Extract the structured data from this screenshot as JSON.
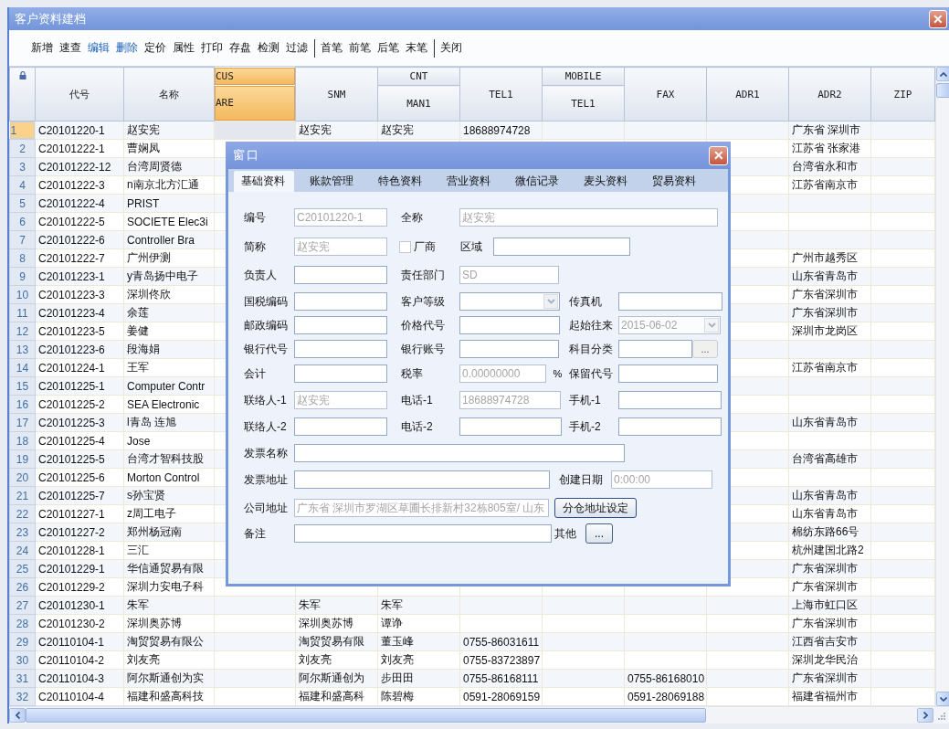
{
  "window": {
    "title": "客户资料建档",
    "close": "✕"
  },
  "toolbar": [
    [
      {
        "label": "新增",
        "highlighted": false
      },
      {
        "label": "速查",
        "highlighted": false
      },
      {
        "label": "编辑",
        "highlighted": true
      },
      {
        "label": "删除",
        "highlighted": true
      },
      {
        "label": "定价",
        "highlighted": false
      },
      {
        "label": "属性",
        "highlighted": false
      },
      {
        "label": "打印",
        "highlighted": false
      },
      {
        "label": "存盘",
        "highlighted": false
      },
      {
        "label": "检测",
        "highlighted": false
      },
      {
        "label": "过滤",
        "highlighted": false
      }
    ],
    [
      {
        "label": "首笔",
        "highlighted": false
      },
      {
        "label": "前笔",
        "highlighted": false
      },
      {
        "label": "后笔",
        "highlighted": false
      },
      {
        "label": "末笔",
        "highlighted": false
      }
    ],
    [
      {
        "label": "关闭",
        "highlighted": false
      }
    ]
  ],
  "table": {
    "columns": [
      {
        "label": "代号",
        "selected": false
      },
      {
        "label": "名称",
        "selected": false
      },
      {
        "group": "CUS",
        "label": "ARE",
        "selected": true
      },
      {
        "label": "SNM",
        "selected": false
      },
      {
        "group": "CNT",
        "label": "MAN1",
        "selected": false
      },
      {
        "label": "TEL1",
        "selected": false
      },
      {
        "group": "MOBILE",
        "label": "TEL1",
        "selected": false
      },
      {
        "label": "FAX",
        "selected": false
      },
      {
        "label": "ADR1",
        "selected": false
      },
      {
        "label": "ADR2",
        "selected": false
      },
      {
        "label": "ZIP",
        "selected": false
      }
    ],
    "rows": [
      {
        "num": "1",
        "selected": true,
        "code": "C20101220-1",
        "name": "赵安宪",
        "snm": "赵安宪",
        "man1": "赵安宪",
        "tel1": "18688974728",
        "adr2": "广东省 深圳市"
      },
      {
        "num": "2",
        "selected": false,
        "code": "C20101222-1",
        "name": "曹娴凤",
        "adr2": "江苏省 张家港"
      },
      {
        "num": "3",
        "selected": false,
        "code": "C20101222-12",
        "name": "台湾周贤德",
        "adr2": "台湾省永和市"
      },
      {
        "num": "4",
        "selected": false,
        "code": "C20101222-3",
        "name": "n南京北方汇通",
        "adr2": "江苏省南京市"
      },
      {
        "num": "5",
        "selected": false,
        "code": "C20101222-4",
        "name": "PRIST"
      },
      {
        "num": "6",
        "selected": false,
        "code": "C20101222-5",
        "name": "SOCIETE Elec3i"
      },
      {
        "num": "7",
        "selected": false,
        "code": "C20101222-6",
        "name": "Controller Bra"
      },
      {
        "num": "8",
        "selected": false,
        "code": "C20101222-7",
        "name": "广州伊测",
        "adr2": "广州市越秀区"
      },
      {
        "num": "9",
        "selected": false,
        "code": "C20101223-1",
        "name": "y青岛扬中电子",
        "adr2": "山东省青岛市"
      },
      {
        "num": "10",
        "selected": false,
        "code": "C20101223-3",
        "name": "深圳佟欣",
        "adr2": "广东省深圳市"
      },
      {
        "num": "11",
        "selected": false,
        "code": "C20101223-4",
        "name": "余莲",
        "adr2": "广东省深圳市"
      },
      {
        "num": "12",
        "selected": false,
        "code": "C20101223-5",
        "name": "姜健",
        "adr2": "深圳市龙岗区"
      },
      {
        "num": "13",
        "selected": false,
        "code": "C20101223-6",
        "name": "段海娟"
      },
      {
        "num": "14",
        "selected": false,
        "code": "C20101224-1",
        "name": "王军",
        "adr2": "江苏省南京市"
      },
      {
        "num": "15",
        "selected": false,
        "code": "C20101225-1",
        "name": "Computer Contr"
      },
      {
        "num": "16",
        "selected": false,
        "code": "C20101225-2",
        "name": "SEA Electronic"
      },
      {
        "num": "17",
        "selected": false,
        "code": "C20101225-3",
        "name": "l青岛 连旭",
        "adr2": "山东省青岛市"
      },
      {
        "num": "18",
        "selected": false,
        "code": "C20101225-4",
        "name": "Jose"
      },
      {
        "num": "19",
        "selected": false,
        "code": "C20101225-5",
        "name": "台湾才智科技股",
        "adr2": "台湾省高雄市"
      },
      {
        "num": "20",
        "selected": false,
        "code": "C20101225-6",
        "name": "Morton Control"
      },
      {
        "num": "21",
        "selected": false,
        "code": "C20101225-7",
        "name": "s孙宝贤",
        "adr2": "山东省青岛市"
      },
      {
        "num": "22",
        "selected": false,
        "code": "C20101227-1",
        "name": "z周工电子",
        "adr2": "山东省青岛市"
      },
      {
        "num": "23",
        "selected": false,
        "code": "C20101227-2",
        "name": "郑州杨冠南",
        "adr2": "棉纺东路66号"
      },
      {
        "num": "24",
        "selected": false,
        "code": "C20101228-1",
        "name": "三汇",
        "adr2": "杭州建国北路2"
      },
      {
        "num": "25",
        "selected": false,
        "code": "C20101229-1",
        "name": "华信通贸易有限",
        "adr2": "广东省深圳市"
      },
      {
        "num": "26",
        "selected": false,
        "code": "C20101229-2",
        "name": "深圳力安电子科",
        "adr2": "广东省深圳市"
      },
      {
        "num": "27",
        "selected": false,
        "code": "C20101230-1",
        "name": "朱军",
        "snm": "朱军",
        "man1": "朱军",
        "adr2": "上海市虹口区"
      },
      {
        "num": "28",
        "selected": false,
        "code": "C20101230-2",
        "name": "深圳奥苏博",
        "snm": "深圳奥苏博",
        "man1": "谭诤",
        "adr2": "广东省深圳市"
      },
      {
        "num": "29",
        "selected": false,
        "code": "C20110104-1",
        "name": "淘贸贸易有限公",
        "snm": "淘贸贸易有限",
        "man1": "董玉峰",
        "tel1": "0755-86031611",
        "adr2": "江西省吉安市"
      },
      {
        "num": "30",
        "selected": false,
        "code": "C20110104-2",
        "name": "刘友亮",
        "snm": "刘友亮",
        "man1": "刘友亮",
        "tel1": "0755-83723897",
        "adr2": "深圳龙华民治"
      },
      {
        "num": "31",
        "selected": false,
        "code": "C20110104-3",
        "name": "阿尔斯通创为实",
        "snm": "阿尔斯通创为",
        "man1": "步田田",
        "tel1": "0755-86168111",
        "fax": "0755-86168010",
        "adr2": "广东省深圳市"
      },
      {
        "num": "32",
        "selected": false,
        "code": "C20110104-4",
        "name": "福建和盛高科技",
        "snm": "福建和盛高科",
        "man1": "陈碧梅",
        "tel1": "0591-28069159",
        "fax": "0591-28069188",
        "adr2": "福建省福州市"
      }
    ]
  },
  "dialog": {
    "title": "窗口",
    "close": "✕",
    "tabs": [
      {
        "label": "基础资料",
        "selected": true
      },
      {
        "label": "账款管理",
        "selected": false
      },
      {
        "label": "特色资料",
        "selected": false
      },
      {
        "label": "营业资料",
        "selected": false
      },
      {
        "label": "微信记录",
        "selected": false
      },
      {
        "label": "麦头资料",
        "selected": false
      },
      {
        "label": "贸易资料",
        "selected": false
      }
    ],
    "form": [
      [
        {
          "kind": "text",
          "label": "编号",
          "value": "C20101220-1",
          "disabled": true
        },
        {
          "kind": "text",
          "label": "全称",
          "value": "赵安宪",
          "disabled": true
        }
      ],
      [
        {
          "kind": "text",
          "label": "简称",
          "value": "赵安宪",
          "disabled": true
        },
        {
          "kind": "checkbox",
          "label": "厂商",
          "checked": false
        },
        {
          "kind": "text",
          "label": "区域",
          "disabled": false
        }
      ],
      [
        {
          "kind": "text",
          "label": "负责人",
          "disabled": false
        },
        {
          "kind": "text",
          "label": "责任部门",
          "value": "SD",
          "disabled": true
        }
      ],
      [
        {
          "kind": "text",
          "label": "国税编码",
          "disabled": false
        },
        {
          "kind": "select",
          "label": "客户等级",
          "disabled": false
        },
        {
          "kind": "text",
          "label": "传真机",
          "disabled": false
        }
      ],
      [
        {
          "kind": "text",
          "label": "邮政编码",
          "disabled": false
        },
        {
          "kind": "text",
          "label": "价格代号",
          "disabled": false
        },
        {
          "kind": "select",
          "label": "起始往来",
          "value": "2015-06-02",
          "disabled": true
        }
      ],
      [
        {
          "kind": "text",
          "label": "银行代号",
          "disabled": false
        },
        {
          "kind": "text",
          "label": "银行账号",
          "disabled": false
        },
        {
          "kind": "browse",
          "label": "科目分类",
          "button": "...",
          "disabled": false
        }
      ],
      [
        {
          "kind": "text",
          "label": "会计",
          "disabled": false
        },
        {
          "kind": "text",
          "label": "税率",
          "value": "0.00000000",
          "suffix": "%",
          "disabled": true
        },
        {
          "kind": "text",
          "label": "保留代号",
          "disabled": false
        }
      ],
      [
        {
          "kind": "text",
          "label": "联络人-1",
          "value": "赵安宪",
          "disabled": true
        },
        {
          "kind": "text",
          "label": "电话-1",
          "value": "18688974728",
          "disabled": true
        },
        {
          "kind": "text",
          "label": "手机-1",
          "disabled": false
        }
      ],
      [
        {
          "kind": "text",
          "label": "联络人-2",
          "disabled": false
        },
        {
          "kind": "text",
          "label": "电话-2",
          "disabled": false
        },
        {
          "kind": "text",
          "label": "手机-2",
          "disabled": false
        }
      ],
      [
        {
          "kind": "text",
          "label": "发票名称",
          "disabled": false
        }
      ],
      [
        {
          "kind": "text",
          "label": "发票地址",
          "disabled": false
        },
        {
          "kind": "text",
          "label": "创建日期",
          "value": "0:00:00",
          "disabled": true
        }
      ],
      [
        {
          "kind": "text",
          "label": "公司地址",
          "value": "广东省 深圳市罗湖区草圃长排新村32栋805室/ 山东",
          "disabled": true
        },
        {
          "kind": "button",
          "button": "分仓地址设定"
        }
      ],
      [
        {
          "kind": "text",
          "label": "备注",
          "disabled": false
        },
        {
          "kind": "button",
          "label": "其他",
          "button": "..."
        }
      ]
    ]
  }
}
